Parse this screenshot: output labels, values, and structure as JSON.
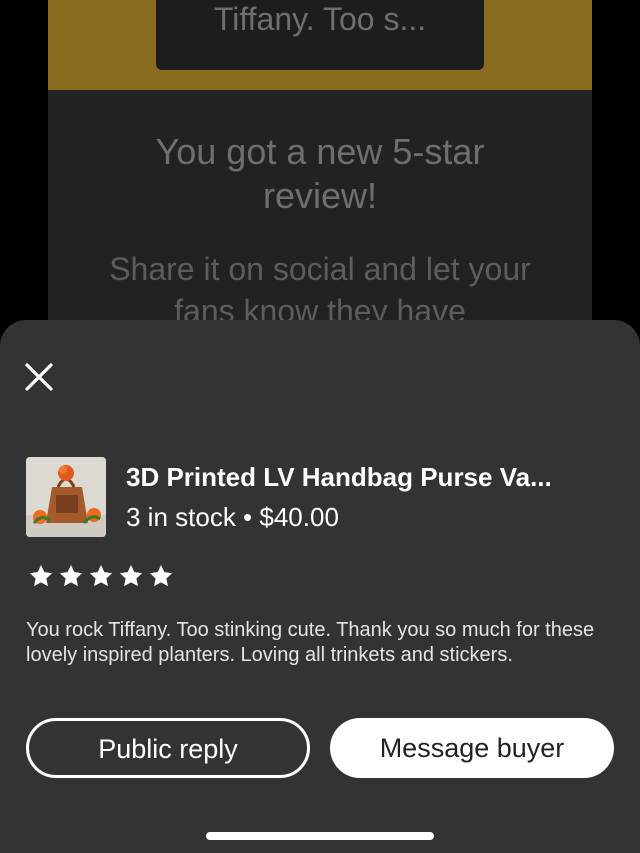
{
  "background": {
    "quote_snippet": "Tiffany.  Too s...",
    "title": "You got a new 5-star review!",
    "subtitle": "Share it on social and let your fans know they have",
    "header_color": "#8a6b1f"
  },
  "sheet": {
    "close_icon": "close-icon",
    "listing": {
      "title": "3D Printed LV Handbag Purse Va...",
      "meta": "3 in stock • $40.00",
      "thumbnail": "product-thumbnail"
    },
    "rating": {
      "stars": 5,
      "max": 5,
      "star_icon": "star-icon"
    },
    "review_text": "You rock Tiffany.  Too stinking cute.  Thank you so much for these lovely inspired planters.  Loving all trinkets and stickers.",
    "actions": {
      "public_reply": "Public reply",
      "message_buyer": "Message buyer"
    }
  }
}
